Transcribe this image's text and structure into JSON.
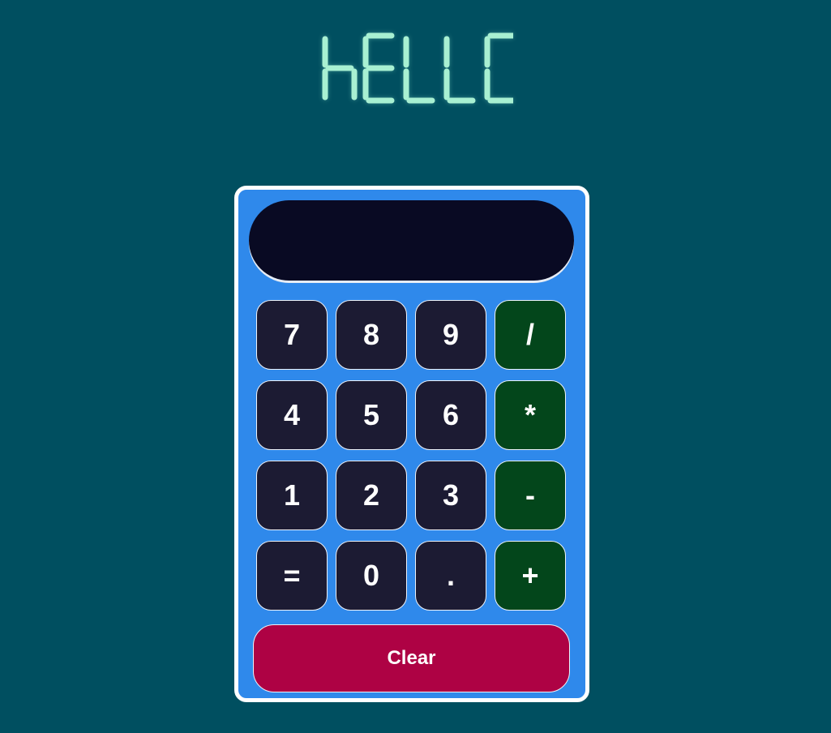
{
  "banner": {
    "text": "hELLO",
    "color": "#a8f0d2"
  },
  "display": {
    "value": ""
  },
  "keypad": {
    "keys": [
      "7",
      "8",
      "9",
      "/",
      "4",
      "5",
      "6",
      "*",
      "1",
      "2",
      "3",
      "-",
      "=",
      "0",
      ".",
      "+"
    ]
  },
  "clear": {
    "label": "Clear"
  },
  "colors": {
    "background": "#004f60",
    "calculator_body": "#2f89eb",
    "display": "#090a23",
    "digit_key": "#1c1b33",
    "operator_key": "#03461b",
    "clear_button": "#ae0244"
  }
}
